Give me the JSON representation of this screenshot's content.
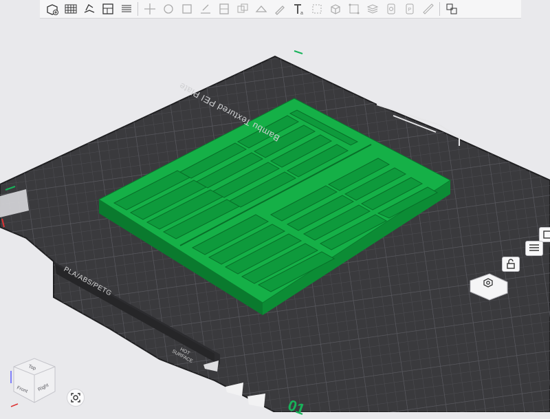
{
  "toolbar": {
    "buttons": [
      {
        "name": "add-object-icon"
      },
      {
        "name": "add-plate-icon"
      },
      {
        "name": "auto-orient-icon"
      },
      {
        "name": "arrange-icon"
      },
      {
        "name": "split-plates-icon"
      },
      {
        "sep": true
      },
      {
        "name": "move-icon"
      },
      {
        "name": "rotate-icon"
      },
      {
        "name": "scale-icon"
      },
      {
        "name": "lay-on-face-icon"
      },
      {
        "name": "cut-icon"
      },
      {
        "name": "mesh-boolean-icon"
      },
      {
        "name": "support-painting-icon"
      },
      {
        "name": "color-painting-icon"
      },
      {
        "name": "text-tool-icon"
      },
      {
        "name": "seam-painting-icon"
      },
      {
        "name": "assembly-icon"
      },
      {
        "name": "measure-icon"
      },
      {
        "name": "variable-layer-icon"
      },
      {
        "name": "fuzzy-skin-icon"
      },
      {
        "name": "emboss-icon"
      },
      {
        "name": "ruler-icon"
      },
      {
        "sep": true
      },
      {
        "name": "assembly-view-icon"
      }
    ]
  },
  "plate": {
    "name": "Bambu Textured PEI Plate",
    "filament": "PLA/ABS/PETG",
    "surface_line1": "HOT",
    "surface_line2": "SURFACE",
    "number": "01"
  },
  "viewcube": {
    "top": "Top",
    "front": "Front",
    "right": "Right"
  },
  "colors": {
    "model": "#0fa23e",
    "model_top": "#15b047",
    "model_dark": "#0a7a2e",
    "plate": "#3a3a3d",
    "grid": "#4b4b4f",
    "plate_edge": "#222224",
    "accent": "#18b35a",
    "background": "#e9e9ec"
  },
  "side_buttons": [
    {
      "name": "toggle-view-icon"
    },
    {
      "name": "layout-icon"
    },
    {
      "name": "unlock-plate-icon"
    },
    {
      "name": "plate-settings-icon"
    }
  ]
}
